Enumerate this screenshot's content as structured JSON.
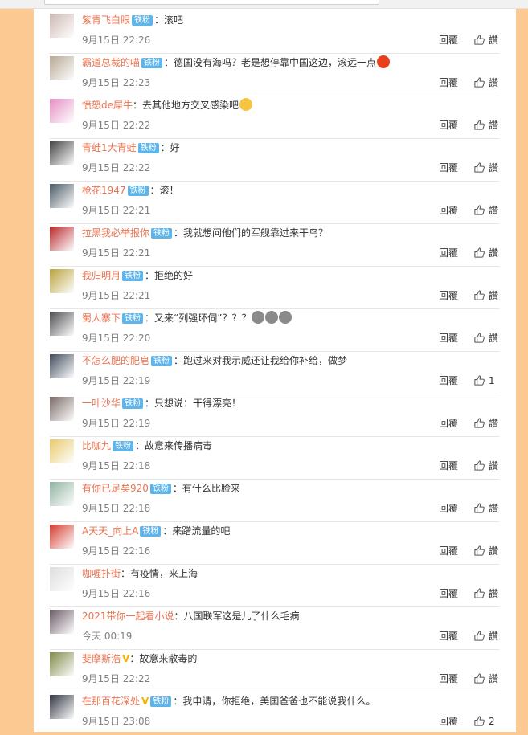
{
  "reply_label": "回覆",
  "like_label": "讚",
  "comments": [
    {
      "user": "紫青飞白眼",
      "badge": "铁粉",
      "vip": "",
      "text": "：滚吧",
      "time": "9月15日 22:26",
      "likes": "",
      "avatar_color": "#cdb8b3",
      "emoji": ""
    },
    {
      "user": "霸道总裁的喵",
      "badge": "铁粉",
      "vip": "",
      "text": "：德国没有海吗？老是想停靠中国这边，滚远一点",
      "time": "9月15日 22:23",
      "likes": "",
      "avatar_color": "#b6a894",
      "emoji": "angry-face-emoji"
    },
    {
      "user": "愤怒de犀牛",
      "badge": "",
      "vip": "",
      "text": "：去其他地方交叉感染吧",
      "time": "9月15日 22:22",
      "likes": "",
      "avatar_color": "#e48fc3",
      "emoji": "drooling-face-emoji"
    },
    {
      "user": "青蛙1大青蛙",
      "badge": "铁粉",
      "vip": "",
      "text": "：好",
      "time": "9月15日 22:22",
      "likes": "",
      "avatar_color": "#444444",
      "emoji": ""
    },
    {
      "user": "枪花1947",
      "badge": "铁粉",
      "vip": "",
      "text": "：滚！",
      "time": "9月15日 22:21",
      "likes": "",
      "avatar_color": "#4a5a64",
      "emoji": ""
    },
    {
      "user": "拉黑我必举报你",
      "badge": "铁粉",
      "vip": "",
      "text": "：我就想问他们的军舰靠过来干鸟？",
      "time": "9月15日 22:21",
      "likes": "",
      "avatar_color": "#b8282c",
      "emoji": ""
    },
    {
      "user": "我归明月",
      "badge": "铁粉",
      "vip": "",
      "text": "：拒绝的好",
      "time": "9月15日 22:21",
      "likes": "",
      "avatar_color": "#b9a23a",
      "emoji": ""
    },
    {
      "user": "蜀人寨下",
      "badge": "铁粉",
      "vip": "",
      "text": "：又来“列强环伺”？？？",
      "time": "9月15日 22:20",
      "likes": "",
      "avatar_color": "#4d4d52",
      "emoji": "skull-emoji"
    },
    {
      "user": "不怎么肥的肥皂",
      "badge": "铁粉",
      "vip": "",
      "text": "：跑过来对我示威还让我给你补给，做梦",
      "time": "9月15日 22:19",
      "likes": "1",
      "avatar_color": "#3f4b5a",
      "emoji": ""
    },
    {
      "user": "一叶沙华",
      "badge": "铁粉",
      "vip": "",
      "text": "：只想说：干得漂亮！",
      "time": "9月15日 22:19",
      "likes": "",
      "avatar_color": "#7a6a66",
      "emoji": ""
    },
    {
      "user": "比咖九",
      "badge": "铁粉",
      "vip": "",
      "text": "：故意来传播病毒",
      "time": "9月15日 22:18",
      "likes": "",
      "avatar_color": "#e9c96a",
      "emoji": ""
    },
    {
      "user": "有你已足矣920",
      "badge": "铁粉",
      "vip": "",
      "text": "：有什么比脸来",
      "time": "9月15日 22:18",
      "likes": "",
      "avatar_color": "#8fb3a0",
      "emoji": ""
    },
    {
      "user": "A天天_向上A",
      "badge": "铁粉",
      "vip": "",
      "text": "：来蹭流量的吧",
      "time": "9月15日 22:16",
      "likes": "",
      "avatar_color": "#d43b2e",
      "emoji": ""
    },
    {
      "user": "咖喱扑街",
      "badge": "",
      "vip": "",
      "text": "：有疫情，来上海",
      "time": "9月15日 22:16",
      "likes": "",
      "avatar_color": "#dddddd",
      "emoji": ""
    },
    {
      "user": "2021带你一起看小说",
      "badge": "",
      "vip": "",
      "text": "：八国联军这是儿了什么毛病",
      "time": "今天 00:19",
      "likes": "",
      "avatar_color": "#6b5a66",
      "emoji": ""
    },
    {
      "user": "斐摩斯浩",
      "badge": "",
      "vip": "V",
      "text": "：故意来散毒的",
      "time": "9月15日 22:22",
      "likes": "",
      "avatar_color": "#7f8a48",
      "emoji": ""
    },
    {
      "user": "在那百花深处",
      "badge": "铁粉",
      "vip": "V",
      "text": "：我申请，你拒绝，美国爸爸也不能说我什么。",
      "time": "9月15日 23:08",
      "likes": "2",
      "avatar_color": "#2f3440",
      "emoji": ""
    }
  ]
}
